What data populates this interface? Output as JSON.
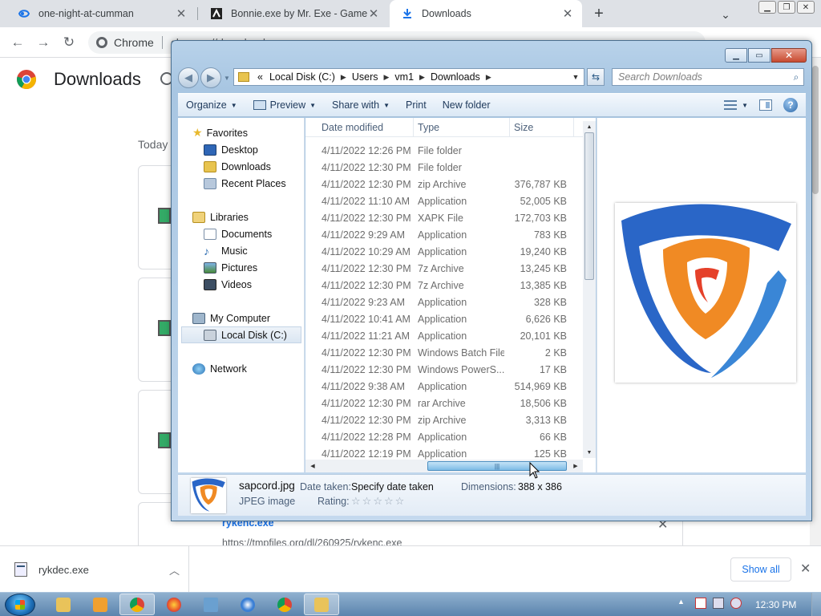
{
  "browser": {
    "tabs": [
      {
        "label": "one-night-at-cumman"
      },
      {
        "label": "Bonnie.exe by Mr. Exe - Game Jo"
      },
      {
        "label": "Downloads",
        "active": true
      }
    ],
    "omnibox": {
      "site_label": "Chrome",
      "url": "chrome://downloads"
    }
  },
  "downloads_page": {
    "title": "Downloads",
    "section_label": "Today",
    "last_item": {
      "filename": "rykenc.exe",
      "url": "https://tmpfiles.org/dl/260925/rykenc.exe"
    }
  },
  "shelf": {
    "item_label": "rykdec.exe",
    "show_all": "Show all"
  },
  "taskbar": {
    "clock": "12:30 PM"
  },
  "explorer": {
    "address": {
      "overflow": "«",
      "crumbs": [
        "Local Disk (C:)",
        "Users",
        "vm1",
        "Downloads"
      ]
    },
    "search_placeholder": "Search Downloads",
    "commands": {
      "organize": "Organize",
      "preview": "Preview",
      "share_with": "Share with",
      "print": "Print",
      "new_folder": "New folder"
    },
    "nav": {
      "favorites": "Favorites",
      "desktop": "Desktop",
      "downloads": "Downloads",
      "recent_places": "Recent Places",
      "libraries": "Libraries",
      "documents": "Documents",
      "music": "Music",
      "pictures": "Pictures",
      "videos": "Videos",
      "my_computer": "My Computer",
      "local_disk": "Local Disk (C:)",
      "network": "Network"
    },
    "columns": {
      "date": "Date modified",
      "type": "Type",
      "size": "Size"
    },
    "rows": [
      {
        "date": "4/11/2022 12:26 PM",
        "type": "File folder",
        "size": ""
      },
      {
        "date": "4/11/2022 12:30 PM",
        "type": "File folder",
        "size": ""
      },
      {
        "date": "4/11/2022 12:30 PM",
        "type": "zip Archive",
        "size": "376,787 KB"
      },
      {
        "date": "4/11/2022 11:10 AM",
        "type": "Application",
        "size": "52,005 KB"
      },
      {
        "date": "4/11/2022 12:30 PM",
        "type": "XAPK File",
        "size": "172,703 KB"
      },
      {
        "date": "4/11/2022 9:29 AM",
        "type": "Application",
        "size": "783 KB"
      },
      {
        "date": "4/11/2022 10:29 AM",
        "type": "Application",
        "size": "19,240 KB"
      },
      {
        "date": "4/11/2022 12:30 PM",
        "type": "7z Archive",
        "size": "13,245 KB"
      },
      {
        "date": "4/11/2022 12:30 PM",
        "type": "7z Archive",
        "size": "13,385 KB"
      },
      {
        "date": "4/11/2022 9:23 AM",
        "type": "Application",
        "size": "328 KB"
      },
      {
        "date": "4/11/2022 10:41 AM",
        "type": "Application",
        "size": "6,626 KB"
      },
      {
        "date": "4/11/2022 11:21 AM",
        "type": "Application",
        "size": "20,101 KB"
      },
      {
        "date": "4/11/2022 12:30 PM",
        "type": "Windows Batch File",
        "size": "2 KB"
      },
      {
        "date": "4/11/2022 12:30 PM",
        "type": "Windows PowerS...",
        "size": "17 KB"
      },
      {
        "date": "4/11/2022 9:38 AM",
        "type": "Application",
        "size": "514,969 KB"
      },
      {
        "date": "4/11/2022 12:30 PM",
        "type": "rar Archive",
        "size": "18,506 KB"
      },
      {
        "date": "4/11/2022 12:30 PM",
        "type": "zip Archive",
        "size": "3,313 KB"
      },
      {
        "date": "4/11/2022 12:28 PM",
        "type": "Application",
        "size": "66 KB"
      },
      {
        "date": "4/11/2022 12:19 PM",
        "type": "Application",
        "size": "125 KB"
      }
    ],
    "details": {
      "filename": "sapcord.jpg",
      "filetype": "JPEG image",
      "date_taken_label": "Date taken:",
      "date_taken_value": "Specify date taken",
      "dimensions_label": "Dimensions:",
      "dimensions_value": "388 x 386",
      "rating_label": "Rating:",
      "rating_stars": 0
    },
    "colors": {
      "logo_blue": "#2a66c7",
      "logo_orange": "#f08a24",
      "logo_red": "#e5412a"
    }
  }
}
